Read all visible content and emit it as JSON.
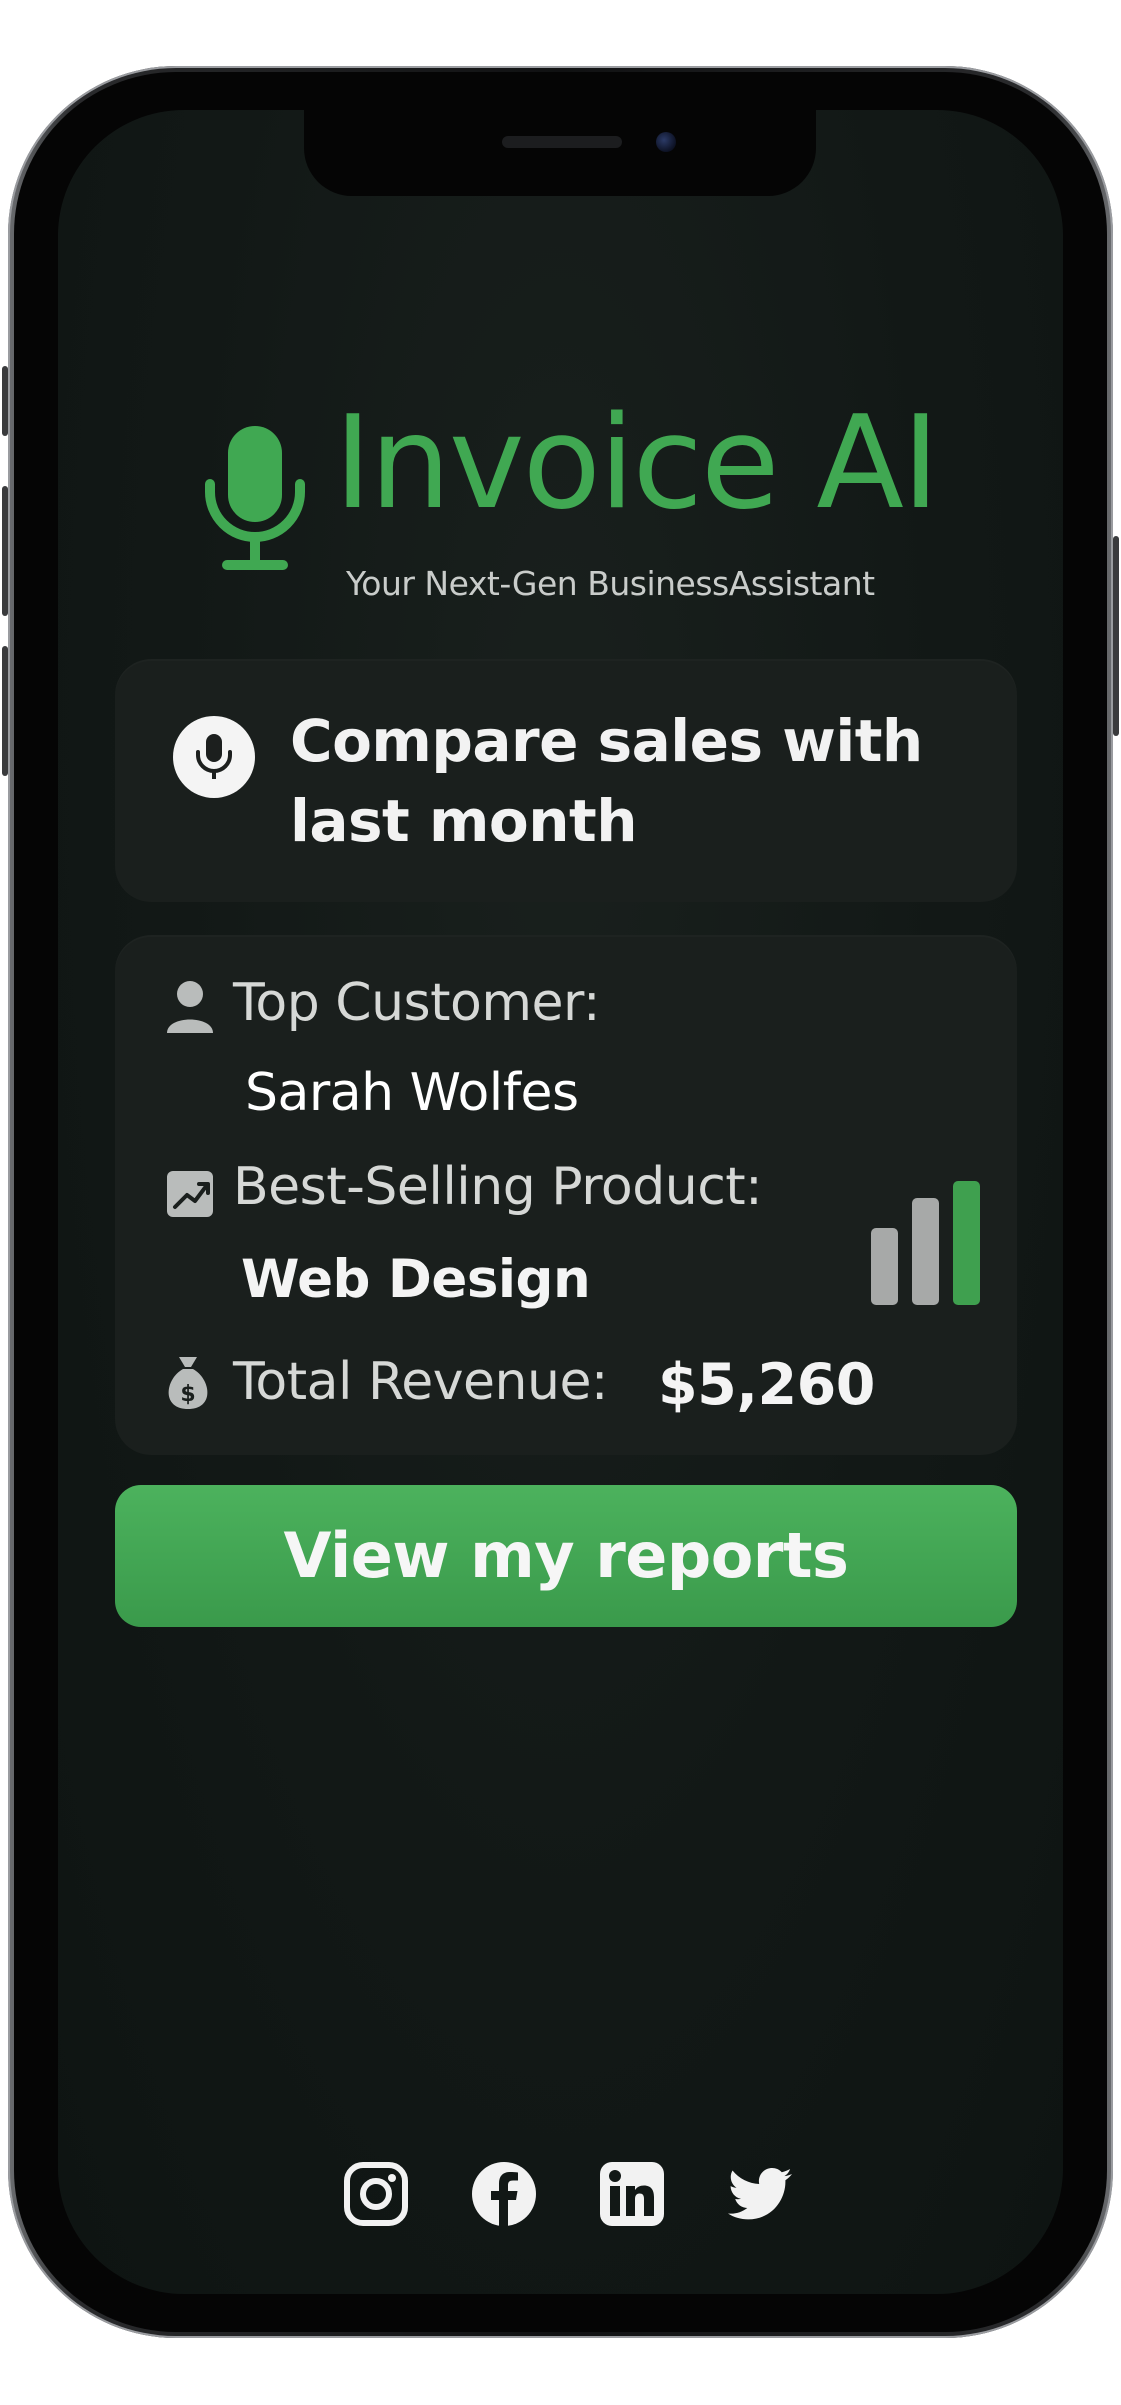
{
  "app": {
    "title": "Invoice AI",
    "tagline": "Your Next-Gen BusinessAssistant"
  },
  "query": {
    "text": "Compare sales with last month",
    "icon": "microphone-icon"
  },
  "stats": {
    "top_customer": {
      "label": "Top Customer:",
      "value": "Sarah Wolfes",
      "icon": "person-icon"
    },
    "best_product": {
      "label": "Best-Selling Product:",
      "value": "Web Design",
      "icon": "trend-chart-icon"
    },
    "revenue": {
      "label": "Total Revenue:",
      "value": "$5,260",
      "icon": "money-bag-icon"
    },
    "bar_chart_icon": {
      "levels": [
        0.62,
        0.86,
        1.0
      ],
      "colors": [
        "#a7a9a8",
        "#a7a9a8",
        "#3fa04f"
      ]
    }
  },
  "cta": {
    "label": "View my reports"
  },
  "socials": [
    {
      "name": "instagram-icon"
    },
    {
      "name": "facebook-icon"
    },
    {
      "name": "linkedin-icon"
    },
    {
      "name": "twitter-icon"
    }
  ],
  "colors": {
    "brand_green": "#40a852",
    "screen_bg": "#121816",
    "card_bg": "#1a1f1d"
  }
}
